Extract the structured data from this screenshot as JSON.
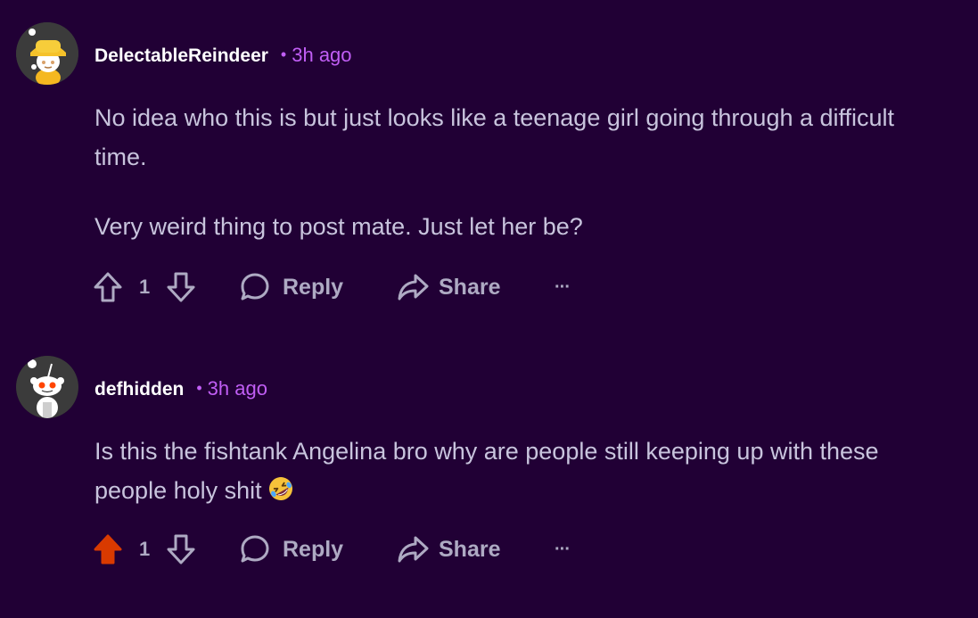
{
  "comments": [
    {
      "username": "DelectableReindeer",
      "separator": "•",
      "time": "3h ago",
      "paragraphs": [
        "No idea who this is but just looks like a teenage girl going through a difficult time.",
        "Very weird thing to post mate. Just let her be?"
      ],
      "score": "1",
      "upvoted": false,
      "reply_label": "Reply",
      "share_label": "Share",
      "more_label": "···",
      "avatar_icon": "snoo-yellow-hat-avatar-icon"
    },
    {
      "username": "defhidden",
      "separator": "•",
      "time": "3h ago",
      "paragraphs": [
        "Is this the fishtank Angelina bro why are people still keeping up with these people holy shit"
      ],
      "emoji_icon": "rolling-on-floor-laughing-emoji",
      "score": "1",
      "upvoted": true,
      "reply_label": "Reply",
      "share_label": "Share",
      "more_label": "···",
      "avatar_icon": "snoo-default-avatar-icon"
    }
  ],
  "colors": {
    "background": "#210035",
    "accent_time": "#c15ef5",
    "upvote_active": "#d93a00",
    "text": "#c8c4dd"
  }
}
